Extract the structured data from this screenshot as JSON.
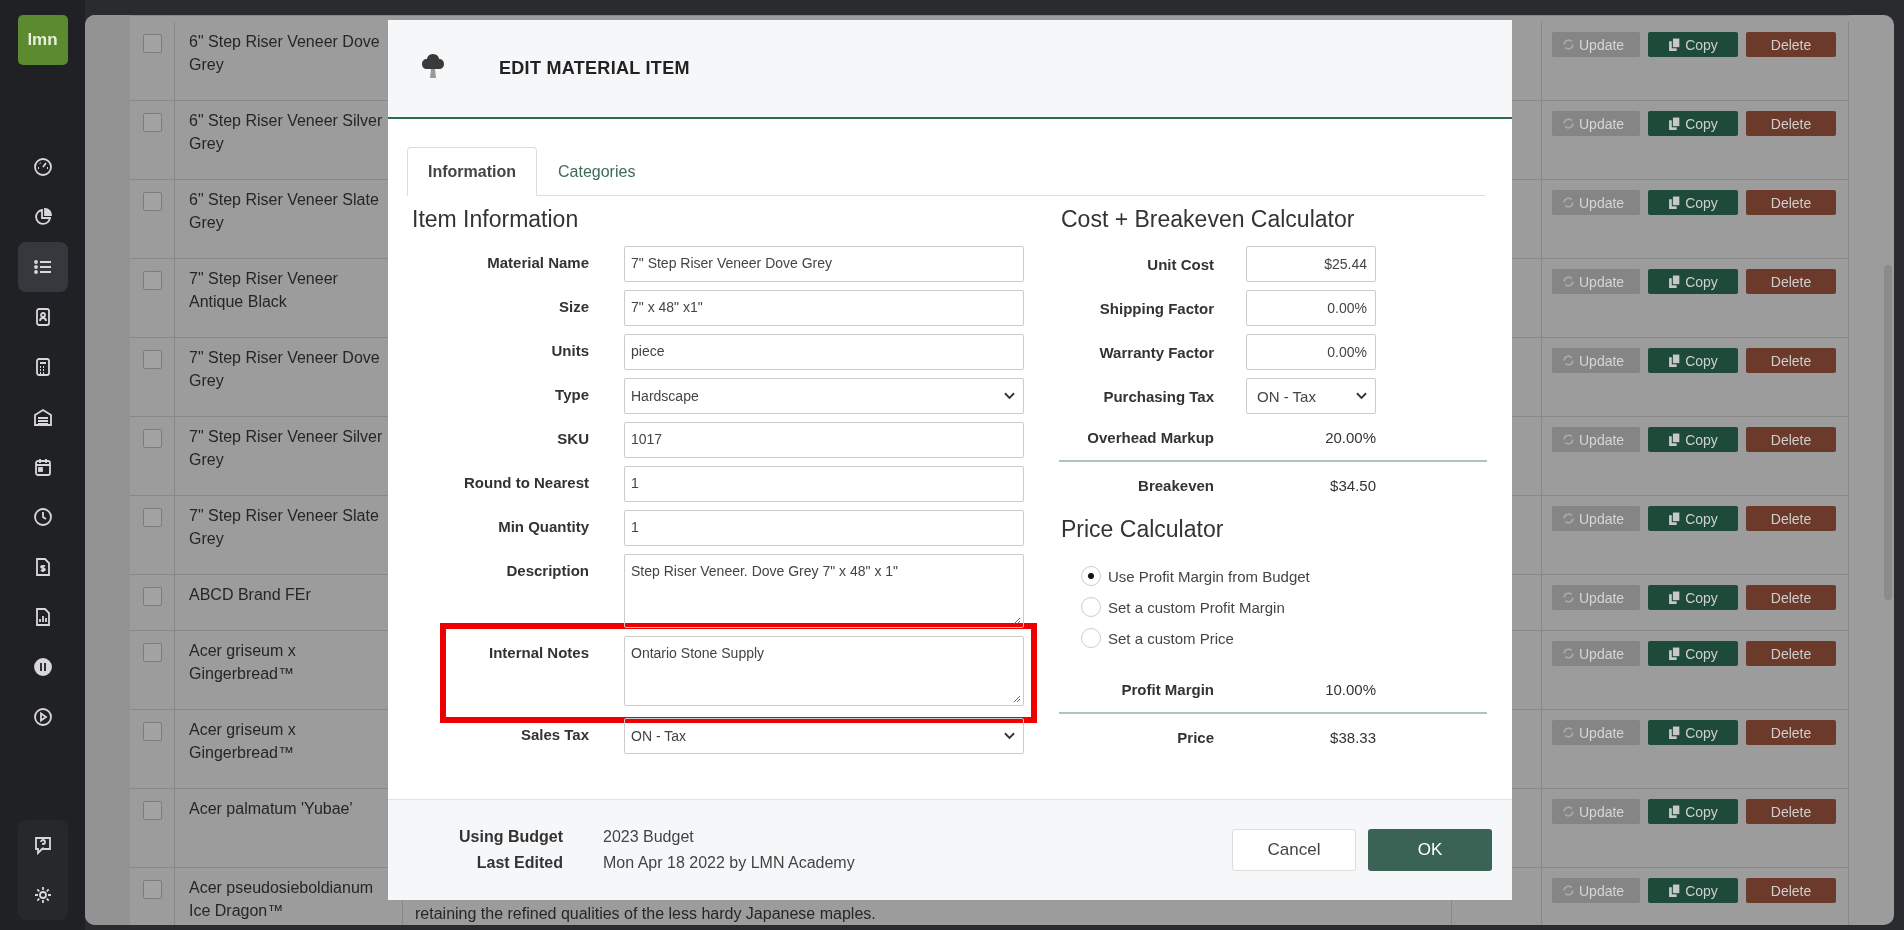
{
  "sidebar": {
    "logo": "lmn",
    "items": [
      {
        "selected": false
      },
      {
        "selected": false
      },
      {
        "selected": true
      },
      {
        "selected": false
      },
      {
        "selected": false
      },
      {
        "selected": false
      },
      {
        "selected": false
      },
      {
        "selected": false
      },
      {
        "selected": false
      },
      {
        "selected": false
      },
      {
        "selected": false
      },
      {
        "selected": false
      }
    ],
    "bottom_items": [
      {
        "selected": false
      },
      {
        "selected": false
      }
    ]
  },
  "table": {
    "rows": [
      {
        "checked": false,
        "name": "6\" Step Riser Veneer Dove Grey",
        "update": "Update",
        "copy": "Copy",
        "delete": "Delete"
      },
      {
        "checked": false,
        "name": "6\" Step Riser Veneer Silver Grey",
        "update": "Update",
        "copy": "Copy",
        "delete": "Delete"
      },
      {
        "checked": false,
        "name": "6\" Step Riser Veneer Slate Grey",
        "update": "Update",
        "copy": "Copy",
        "delete": "Delete"
      },
      {
        "checked": false,
        "name": "7\" Step Riser Veneer Antique Black",
        "update": "Update",
        "copy": "Copy",
        "delete": "Delete"
      },
      {
        "checked": false,
        "name": "7\" Step Riser Veneer Dove Grey",
        "update": "Update",
        "copy": "Copy",
        "delete": "Delete"
      },
      {
        "checked": false,
        "name": "7\" Step Riser Veneer Silver Grey",
        "update": "Update",
        "copy": "Copy",
        "delete": "Delete"
      },
      {
        "checked": false,
        "name": "7\" Step Riser Veneer Slate Grey",
        "update": "Update",
        "copy": "Copy",
        "delete": "Delete"
      },
      {
        "checked": false,
        "name": "ABCD Brand FEr",
        "update": "Update",
        "copy": "Copy",
        "delete": "Delete"
      },
      {
        "checked": false,
        "name": "Acer griseum x Gingerbread™",
        "update": "Update",
        "copy": "Copy",
        "delete": "Delete"
      },
      {
        "checked": false,
        "name": "Acer griseum x Gingerbread™",
        "update": "Update",
        "copy": "Copy",
        "delete": "Delete"
      },
      {
        "checked": false,
        "name": "Acer palmatum 'Yubae'",
        "update": "Update",
        "copy": "Copy",
        "delete": "Delete"
      },
      {
        "checked": false,
        "name": "Acer pseudosieboldianum Ice Dragon™",
        "update": "Update",
        "copy": "Copy",
        "delete": "Delete",
        "description": "retaining the refined qualities of the less hardy Japanese maples."
      }
    ]
  },
  "modal": {
    "title": "EDIT MATERIAL ITEM",
    "tabs": [
      {
        "label": "Information",
        "selected": true
      },
      {
        "label": "Categories",
        "selected": false
      }
    ],
    "item_information": {
      "title": "Item Information",
      "fields": [
        {
          "label": "Material Name",
          "kind": "input",
          "value": "7\" Step Riser Veneer Dove Grey"
        },
        {
          "label": "Size",
          "kind": "input",
          "value": "7\" x 48\" x1\""
        },
        {
          "label": "Units",
          "kind": "input",
          "value": "piece"
        },
        {
          "label": "Type",
          "kind": "select",
          "value": "Hardscape"
        },
        {
          "label": "SKU",
          "kind": "input",
          "value": "1017"
        },
        {
          "label": "Round to Nearest",
          "kind": "input",
          "value": "1"
        },
        {
          "label": "Min Quantity",
          "kind": "input",
          "value": "1"
        },
        {
          "label": "Description",
          "kind": "textarea",
          "value": "Step Riser Veneer. Dove Grey 7\" x 48\" x 1\"",
          "highlighted": false
        },
        {
          "label": "Internal Notes",
          "kind": "textarea",
          "value": "Ontario Stone Supply",
          "highlighted": true
        },
        {
          "label": "Sales Tax",
          "kind": "select",
          "value": "ON - Tax"
        }
      ]
    },
    "cost_calculator": {
      "title": "Cost + Breakeven Calculator",
      "fields": [
        {
          "label": "Unit Cost",
          "kind": "input",
          "value": "$25.44"
        },
        {
          "label": "Shipping Factor",
          "kind": "input",
          "value": "0.00%"
        },
        {
          "label": "Warranty Factor",
          "kind": "input",
          "value": "0.00%"
        },
        {
          "label": "Purchasing Tax",
          "kind": "select",
          "value": "ON - Tax"
        },
        {
          "label": "Overhead Markup",
          "kind": "text",
          "value": "20.00%"
        },
        {
          "label": "Breakeven",
          "kind": "total",
          "value": "$34.50"
        }
      ]
    },
    "price_calculator": {
      "title": "Price Calculator",
      "options": [
        {
          "label": "Use Profit Margin from Budget",
          "selected": true
        },
        {
          "label": "Set a custom Profit Margin",
          "selected": false
        },
        {
          "label": "Set a custom Price",
          "selected": false
        }
      ],
      "fields": [
        {
          "label": "Profit Margin",
          "kind": "text",
          "value": "10.00%"
        },
        {
          "label": "Price",
          "kind": "total",
          "value": "$38.33"
        }
      ]
    },
    "footer": {
      "meta": [
        {
          "label": "Using Budget",
          "value": "2023 Budget"
        },
        {
          "label": "Last Edited",
          "value": "Mon Apr 18 2022 by LMN Academy"
        }
      ],
      "buttons": [
        {
          "label": "Cancel",
          "kind": "secondary"
        },
        {
          "label": "OK",
          "kind": "primary"
        }
      ]
    }
  }
}
